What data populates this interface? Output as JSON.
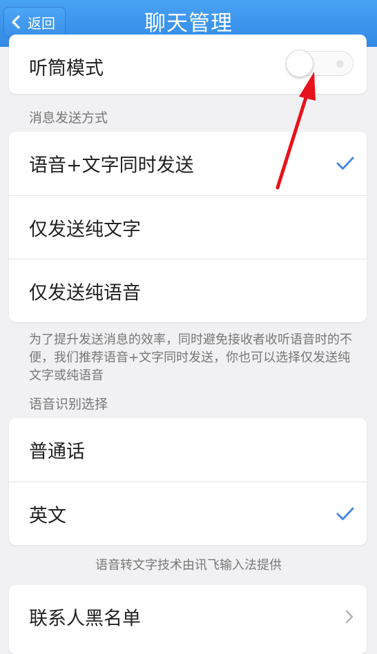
{
  "header": {
    "back_label": "返回",
    "title": "聊天管理"
  },
  "earpiece": {
    "label": "听筒模式",
    "toggle_on": false
  },
  "send_mode": {
    "section_label": "消息发送方式",
    "options": [
      {
        "label": "语音+文字同时发送",
        "selected": true
      },
      {
        "label": "仅发送纯文字",
        "selected": false
      },
      {
        "label": "仅发送纯语音",
        "selected": false
      }
    ],
    "note": "为了提升发送消息的效率，同时避免接收者收听语音时的不便，我们推荐语音+文字同时发送，你也可以选择仅发送纯文字或纯语音"
  },
  "recognition": {
    "section_label": "语音识别选择",
    "options": [
      {
        "label": "普通话",
        "selected": false
      },
      {
        "label": "英文",
        "selected": true
      }
    ],
    "note": "语音转文字技术由讯飞输入法提供"
  },
  "blacklist": {
    "label": "联系人黑名单"
  },
  "colors": {
    "nav_blue": "#3a8ee6",
    "check_blue": "#4a86e8",
    "arrow_red": "#e8121b"
  }
}
